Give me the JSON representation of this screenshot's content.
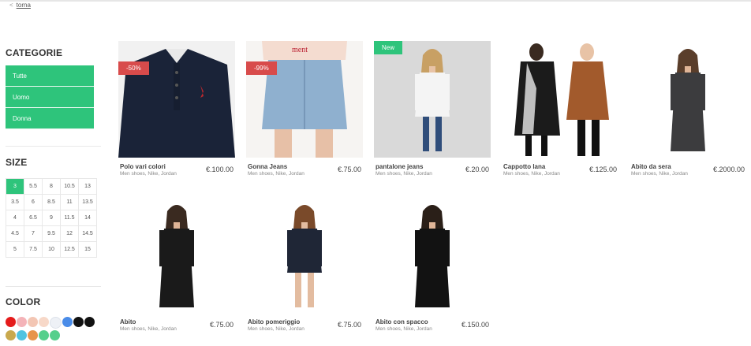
{
  "nav": {
    "back_chevron": "<",
    "back_label": "torna"
  },
  "sidebar": {
    "categories_title": "CATEGORIE",
    "categories": [
      "Tutte",
      "Uomo",
      "Donna"
    ],
    "size_title": "SIZE",
    "sizes": [
      "3",
      "5.5",
      "8",
      "10.5",
      "13",
      "3.5",
      "6",
      "8.5",
      "11",
      "13.5",
      "4",
      "6.5",
      "9",
      "11.5",
      "14",
      "4.5",
      "7",
      "9.5",
      "12",
      "14.5",
      "5",
      "7.5",
      "10",
      "12.5",
      "15"
    ],
    "selected_size": "3",
    "color_title": "COLOR",
    "colors_row1": [
      "#e51b1b",
      "#f4b3b8",
      "#f3c6b4",
      "#f7d8c8",
      "#eef1f6",
      "#4a8ce8",
      "#111111",
      "#111111"
    ],
    "colors_row2": [
      "#c9a94e",
      "#4fc3e0",
      "#e7944a",
      "#55cf8c",
      "#55cf8c"
    ]
  },
  "products": [
    {
      "name": "Polo vari colori",
      "tags": "Men shoes, Nike, Jordan",
      "price": "€.100.00",
      "badge": "-50%",
      "badge_type": "sale"
    },
    {
      "name": "Gonna Jeans",
      "tags": "Men shoes, Nike, Jordan",
      "price": "€.75.00",
      "badge": "-99%",
      "badge_type": "sale"
    },
    {
      "name": "pantalone jeans",
      "tags": "Men shoes, Nike, Jordan",
      "price": "€.20.00",
      "badge": "New",
      "badge_type": "new"
    },
    {
      "name": "Cappotto lana",
      "tags": "Men shoes, Nike, Jordan",
      "price": "€.125.00",
      "badge": "",
      "badge_type": ""
    },
    {
      "name": "Abito da sera",
      "tags": "Men shoes, Nike, Jordan",
      "price": "€.2000.00",
      "badge": "",
      "badge_type": ""
    },
    {
      "name": "Abito",
      "tags": "Men shoes, Nike, Jordan",
      "price": "€.75.00",
      "badge": "",
      "badge_type": ""
    },
    {
      "name": "Abito pomeriggio",
      "tags": "Men shoes, Nike, Jordan",
      "price": "€.75.00",
      "badge": "",
      "badge_type": ""
    },
    {
      "name": "Abito con spacco",
      "tags": "Men shoes, Nike, Jordan",
      "price": "€.150.00",
      "badge": "",
      "badge_type": ""
    }
  ]
}
